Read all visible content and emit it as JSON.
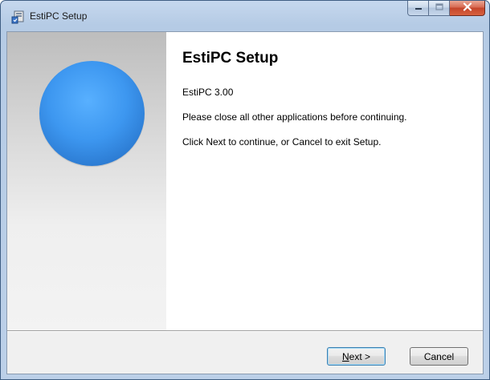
{
  "window": {
    "title": "EstiPC Setup"
  },
  "content": {
    "heading": "EstiPC Setup",
    "version": "EstiPC 3.00",
    "line1": "Please close all other applications before continuing.",
    "line2": "Click Next to continue, or Cancel to exit Setup."
  },
  "buttons": {
    "next_mnemonic": "N",
    "next_rest": "ext >",
    "cancel": "Cancel"
  },
  "colors": {
    "sphere": "#3d97f0",
    "titlebar": "#c6d8ee",
    "close_button": "#c4452b"
  },
  "icons": {
    "title": "setup-installer-icon",
    "minimize": "minimize-icon",
    "maximize": "maximize-icon",
    "close": "close-icon"
  }
}
